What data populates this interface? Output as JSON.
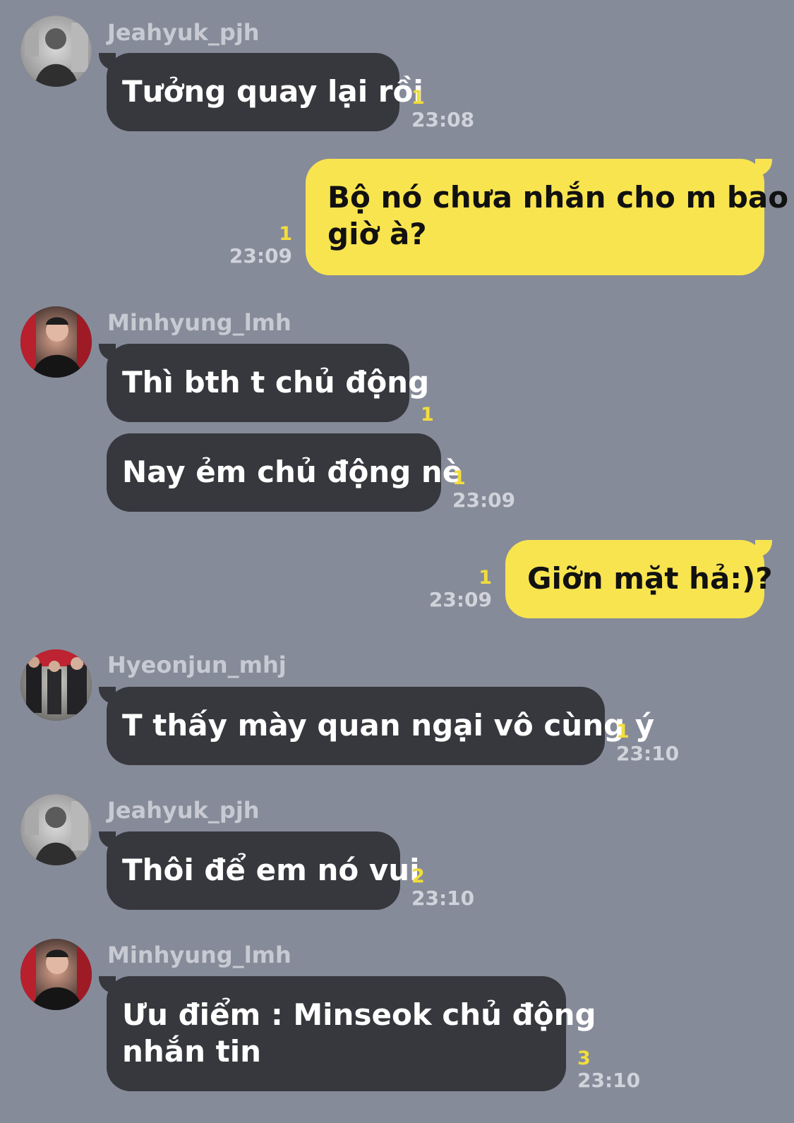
{
  "messages": [
    {
      "sender": "Jeahyuk_pjh",
      "text": "Tưởng quay lại rồi",
      "unread": "1",
      "time": "23:08"
    },
    {
      "text_line1": "Bộ nó chưa nhắn cho m bao",
      "text_line2": "giờ à?",
      "unread": "1",
      "time": "23:09"
    },
    {
      "sender": "Minhyung_lmh",
      "text": "Thì bth t chủ động",
      "unread": "1"
    },
    {
      "text": "Nay ẻm chủ động nè",
      "unread": "1",
      "time": "23:09"
    },
    {
      "text": "Giỡn mặt hả:)?",
      "unread": "1",
      "time": "23:09"
    },
    {
      "sender": "Hyeonjun_mhj",
      "text": "T thấy mày quan ngại vô cùng ý",
      "unread": "1",
      "time": "23:10"
    },
    {
      "sender": "Jeahyuk_pjh",
      "text": "Thôi để em nó vui",
      "unread": "2",
      "time": "23:10"
    },
    {
      "sender": "Minhyung_lmh",
      "text_line1": "Ưu điểm : Minseok chủ động",
      "text_line2": "nhắn tin",
      "unread": "3",
      "time": "23:10"
    }
  ],
  "avatars": [
    {
      "name": "avatar-jeahyuk-photo"
    },
    {
      "name": "avatar-minhyung-photo"
    },
    {
      "name": "avatar-hyeonjun-photo"
    }
  ],
  "colors": {
    "background": "#868b99",
    "incoming_bubble": "#37383d",
    "outgoing_bubble": "#f8e44f",
    "unread_count": "#f2dd3b",
    "timestamp": "#d0d3da",
    "sender_name": "#c7cad2"
  }
}
